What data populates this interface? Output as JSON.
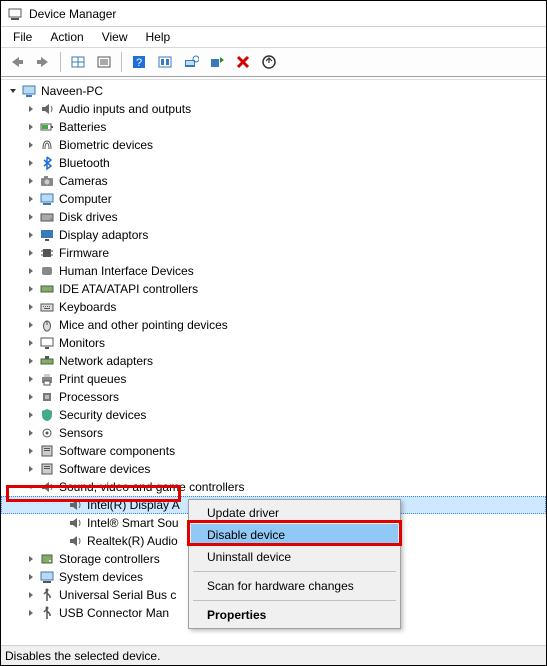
{
  "title": "Device Manager",
  "menu": {
    "file": "File",
    "action": "Action",
    "view": "View",
    "help": "Help"
  },
  "root": "Naveen-PC",
  "categories": [
    "Audio inputs and outputs",
    "Batteries",
    "Biometric devices",
    "Bluetooth",
    "Cameras",
    "Computer",
    "Disk drives",
    "Display adaptors",
    "Firmware",
    "Human Interface Devices",
    "IDE ATA/ATAPI controllers",
    "Keyboards",
    "Mice and other pointing devices",
    "Monitors",
    "Network adapters",
    "Print queues",
    "Processors",
    "Security devices",
    "Sensors",
    "Software components",
    "Software devices",
    "Sound, video and game controllers",
    "Storage controllers",
    "System devices",
    "Universal Serial Bus c",
    "USB Connector Man"
  ],
  "expanded_index": 21,
  "sound_children": [
    "Intel(R) Display A",
    "Intel® Smart Sou",
    "Realtek(R) Audio"
  ],
  "selected_child_index": 0,
  "context_menu": {
    "update": "Update driver",
    "disable": "Disable device",
    "uninstall": "Uninstall device",
    "scan": "Scan for hardware changes",
    "properties": "Properties",
    "highlighted": "disable"
  },
  "status": "Disables the selected device."
}
